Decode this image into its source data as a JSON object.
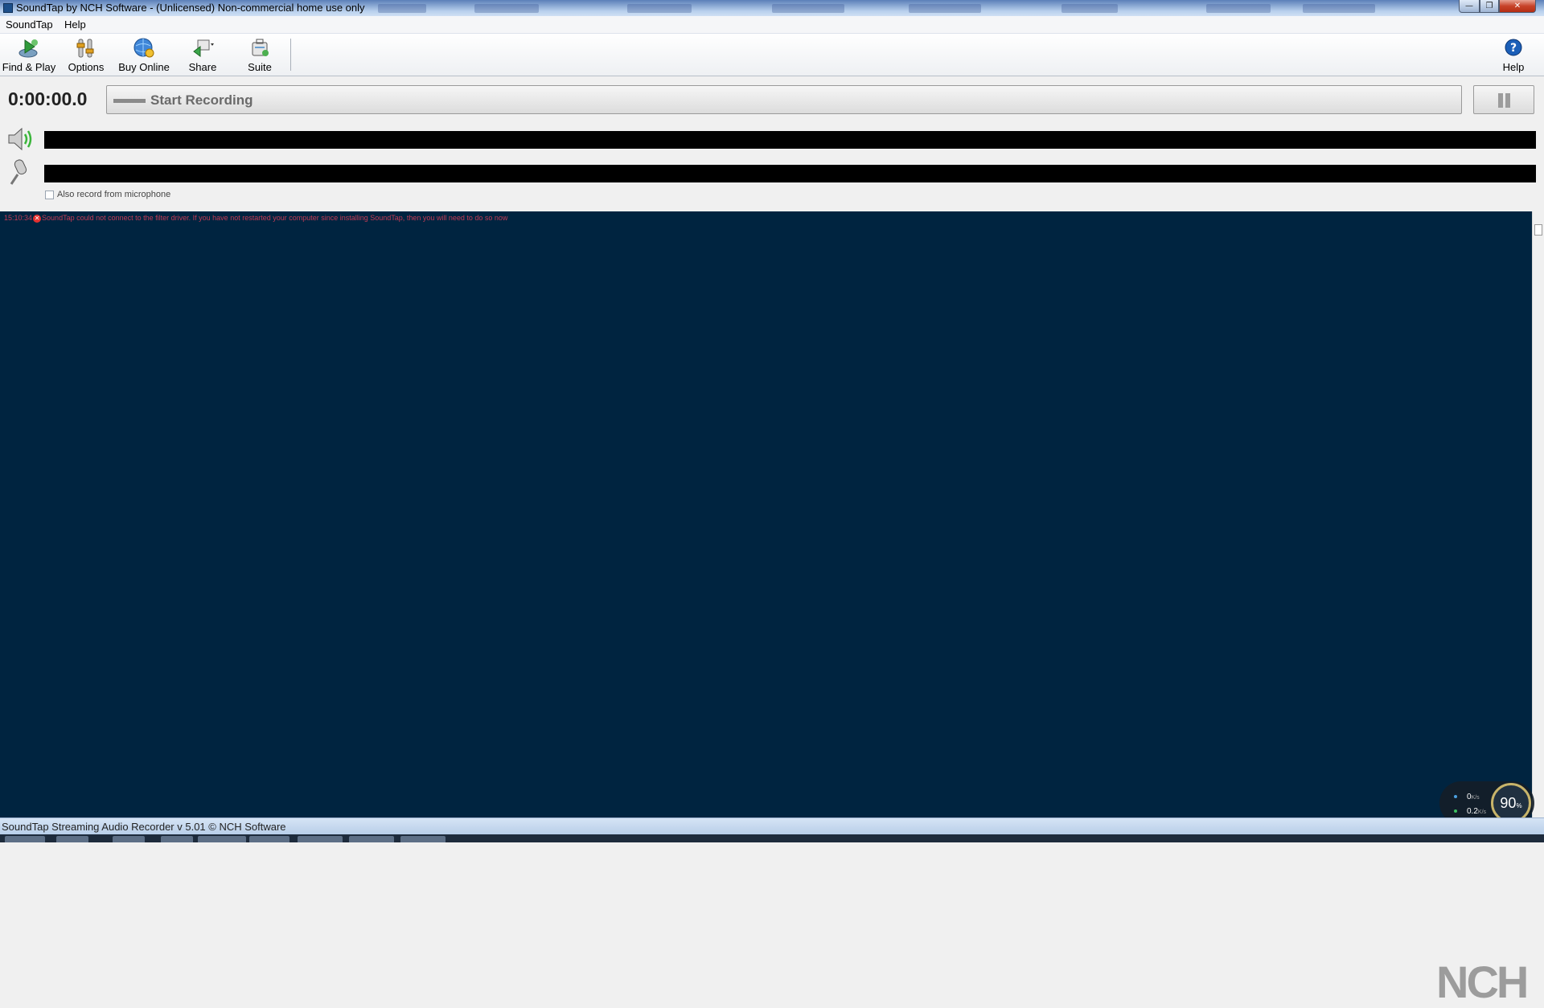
{
  "window": {
    "title": "SoundTap by NCH Software - (Unlicensed) Non-commercial home use only",
    "minimize_glyph": "—",
    "maximize_glyph": "❐",
    "close_glyph": "✕"
  },
  "menu": [
    {
      "label": "SoundTap"
    },
    {
      "label": "Help"
    }
  ],
  "toolbar": {
    "buttons": [
      {
        "label": "Find & Play",
        "icon": "find-play-icon"
      },
      {
        "label": "Options",
        "icon": "options-icon"
      },
      {
        "label": "Buy Online",
        "icon": "buy-online-icon"
      },
      {
        "label": "Share",
        "icon": "share-icon"
      },
      {
        "label": "Suite",
        "icon": "suite-icon"
      }
    ],
    "help_label": "Help"
  },
  "recorder": {
    "elapsed": "0:00:00.0",
    "record_label": "Start Recording",
    "mic_checkbox_label": "Also record from microphone",
    "mic_checkbox_checked": false
  },
  "log": {
    "time": "15:10:34",
    "message": "SoundTap could not connect to the filter driver. If you have not restarted your computer since installing SoundTap, then you will need to do so now",
    "color": "#c53b55"
  },
  "watermark": "NCH",
  "net_widget": {
    "up_value": "0",
    "up_unit": "K/s",
    "down_value": "0.2",
    "down_unit": "K/s",
    "percent": "90",
    "percent_sign": "%"
  },
  "status": {
    "text": "SoundTap Streaming Audio Recorder v 5.01 © NCH Software"
  },
  "colors": {
    "log_background": "#002440",
    "meter_background": "#000000"
  }
}
